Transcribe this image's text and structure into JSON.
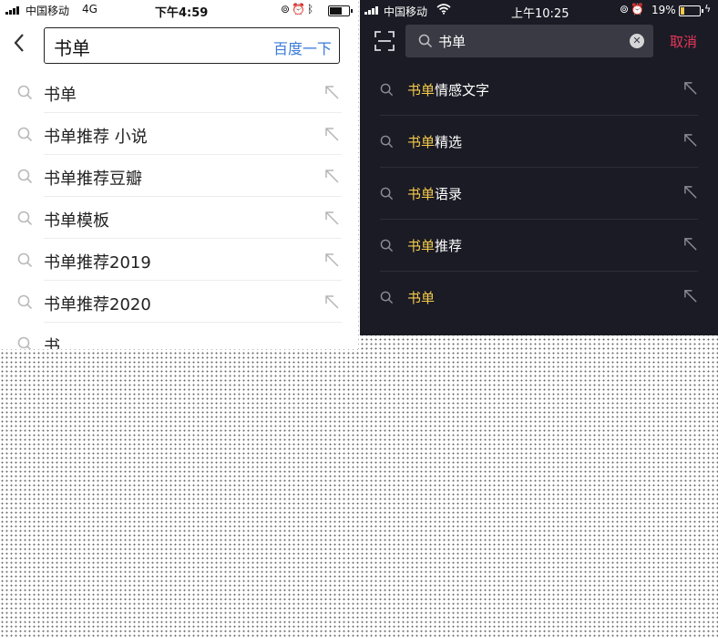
{
  "left_screen": {
    "status_bar": {
      "carrier": "中国移动",
      "network": "4G",
      "time": "下午4:59"
    },
    "search": {
      "query": "书单",
      "submit_label": "百度一下"
    },
    "suggestions": [
      {
        "text": "书单"
      },
      {
        "text": "书单推荐 小说"
      },
      {
        "text": "书单推荐豆瓣"
      },
      {
        "text": "书单模板"
      },
      {
        "text": "书单推荐2019"
      },
      {
        "text": "书单推荐2020"
      },
      {
        "text": "书"
      }
    ]
  },
  "right_screen": {
    "status_bar": {
      "carrier": "中国移动",
      "time": "上午10:25",
      "battery": "19%",
      "battery_level": 0.19
    },
    "search": {
      "query": "书单",
      "cancel_label": "取消"
    },
    "suggestions": [
      {
        "highlight": "书单",
        "rest": "情感文字"
      },
      {
        "highlight": "书单",
        "rest": "精选"
      },
      {
        "highlight": "书单",
        "rest": "语录"
      },
      {
        "highlight": "书单",
        "rest": "推荐"
      },
      {
        "highlight": "书单",
        "rest": ""
      }
    ]
  },
  "colors": {
    "left_link": "#3b7bd8",
    "right_bg": "#1b1b25",
    "right_highlight": "#f2c94c",
    "right_cancel": "#e8375a"
  },
  "icons": [
    "signal-icon",
    "back-arrow-icon",
    "search-icon",
    "fill-arrow-icon",
    "scan-icon",
    "clear-icon",
    "wifi-icon",
    "alarm-icon",
    "bluetooth-icon",
    "battery-icon"
  ]
}
